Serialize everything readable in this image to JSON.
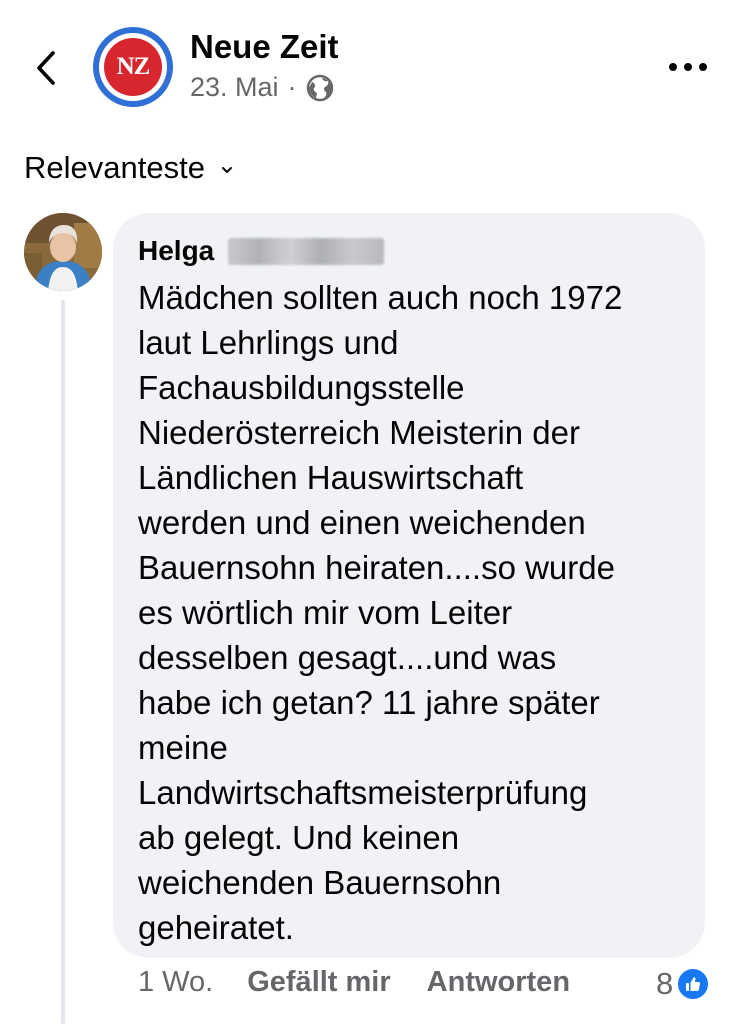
{
  "header": {
    "logo_text": "NZ",
    "page_name": "Neue Zeit",
    "date": "23. Mai",
    "separator": "·",
    "audience_icon": "globe-icon",
    "back_icon": "chevron-left-icon",
    "more_icon": "more-dots-icon"
  },
  "sort": {
    "label": "Relevanteste",
    "icon": "chevron-down-icon"
  },
  "comment": {
    "author_first_name": "Helga",
    "author_last_name_redacted": true,
    "text": "Mädchen sollten auch noch 1972\nlaut Lehrlings und\nFachausbildungsstelle\nNiederösterreich Meisterin der\nLändlichen Hauswirtschaft\nwerden und einen weichenden\nBauernsohn heiraten....so wurde\nes wörtlich mir vom Leiter\ndesselben gesagt....und was\nhabe ich getan? 11 jahre später\nmeine\nLandwirtschaftsmeisterprüfung\nab gelegt. Und keinen\nweichenden Bauernsohn\ngeheiratet.",
    "time": "1 Wo.",
    "like_label": "Gefällt mir",
    "reply_label": "Antworten",
    "reaction_count": "8",
    "reaction_icon": "thumbs-up-icon"
  },
  "colors": {
    "brand_blue": "#1877f2",
    "bubble_bg": "#f0f2f5",
    "secondary_text": "#65676b",
    "logo_red": "#d7262e",
    "logo_ring_blue": "#2f6fd6"
  }
}
